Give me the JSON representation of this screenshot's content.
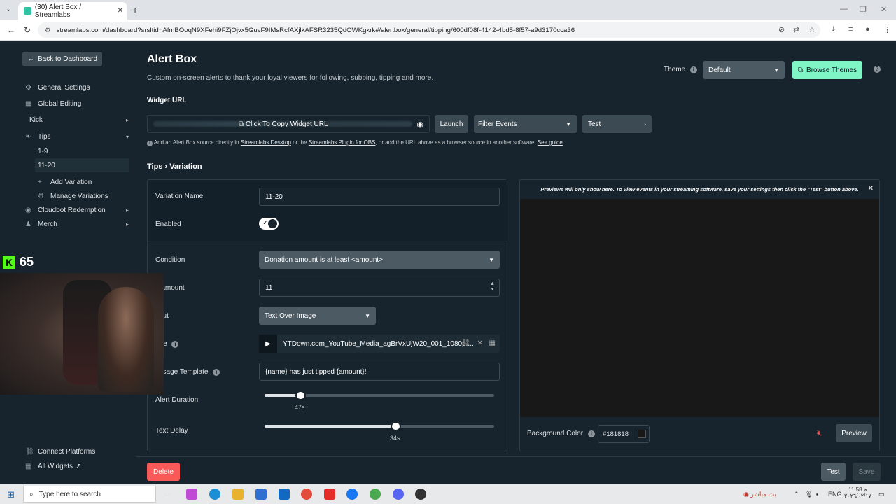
{
  "browser": {
    "tab_title": "(30) Alert Box / Streamlabs",
    "url": "streamlabs.com/dashboard?srsltid=AfmBOoqN9XFehi9FZjOjvx5GuvF9IMsRcfAXjlkAFSR3235QdOWKgkrk#/alertbox/general/tipping/600df08f-4142-4bd5-8f57-a9d3170cca36"
  },
  "sidebar": {
    "back": "Back to Dashboard",
    "items": [
      {
        "label": "General Settings",
        "icon": "gear-icon"
      },
      {
        "label": "Global Editing",
        "icon": "grid-icon"
      },
      {
        "label": "Kick",
        "icon": ""
      },
      {
        "label": "Tips",
        "icon": "leaf-icon"
      },
      {
        "label": "Cloudbot Redemption",
        "icon": "bot-icon"
      },
      {
        "label": "Merch",
        "icon": "shirt-icon"
      }
    ],
    "tips_sub": [
      "1-9",
      "11-20"
    ],
    "add_variation": "Add Variation",
    "manage_variations": "Manage Variations",
    "connect_platforms": "Connect Platforms",
    "all_widgets": "All Widgets"
  },
  "header": {
    "title": "Alert Box",
    "description": "Custom on-screen alerts to thank your loyal viewers for following, subbing, tipping and more.",
    "widget_url_label": "Widget URL",
    "theme_label": "Theme",
    "theme_value": "Default",
    "browse_themes": "Browse Themes"
  },
  "widget": {
    "copy_label": "Click To Copy Widget URL",
    "launch": "Launch",
    "filter_events": "Filter Events",
    "test": "Test",
    "hint_1": "Add an Alert Box source directly in",
    "hint_link_1": "Streamlabs Desktop",
    "hint_2": "or the",
    "hint_link_2": "Streamlabs Plugin for OBS",
    "hint_3": ", or add the URL above as a browser source in another software.",
    "hint_link_3": "See guide"
  },
  "breadcrumb": "Tips › Variation",
  "form": {
    "variation_name_label": "Variation Name",
    "variation_name_value": "11-20",
    "enabled_label": "Enabled",
    "condition_label": "Condition",
    "condition_value": "Donation amount is at least <amount>",
    "amount_label": "o amount",
    "amount_value": "11",
    "layout_label": "yout",
    "layout_value": "Text Over Image",
    "image_label": "age",
    "image_value": "YTDown.com_YouTube_Media_agBrVxUjW20_001_1080p....",
    "message_label": "essage Template",
    "message_value": "{name} has just tipped {amount}!",
    "alert_duration_label": "Alert Duration",
    "alert_duration_value": "47s",
    "alert_duration_fraction": 0.155,
    "text_delay_label": "Text Delay",
    "text_delay_value": "34s",
    "text_delay_fraction": 0.57
  },
  "preview": {
    "message": "Previews will only show here. To view events in your streaming software, save your settings then click the \"Test\" button above.",
    "bg_label": "Background Color",
    "bg_value": "#181818",
    "preview_btn": "Preview"
  },
  "footer": {
    "delete": "Delete",
    "test": "Test",
    "save": "Save"
  },
  "overlay": {
    "kick_count": "65"
  },
  "taskbar": {
    "search_placeholder": "Type here to search",
    "lang": "ENG",
    "time": "11:58 م",
    "date": "٢٠٢٦/٠٢/١٧",
    "live_label": "بث مباشر"
  }
}
